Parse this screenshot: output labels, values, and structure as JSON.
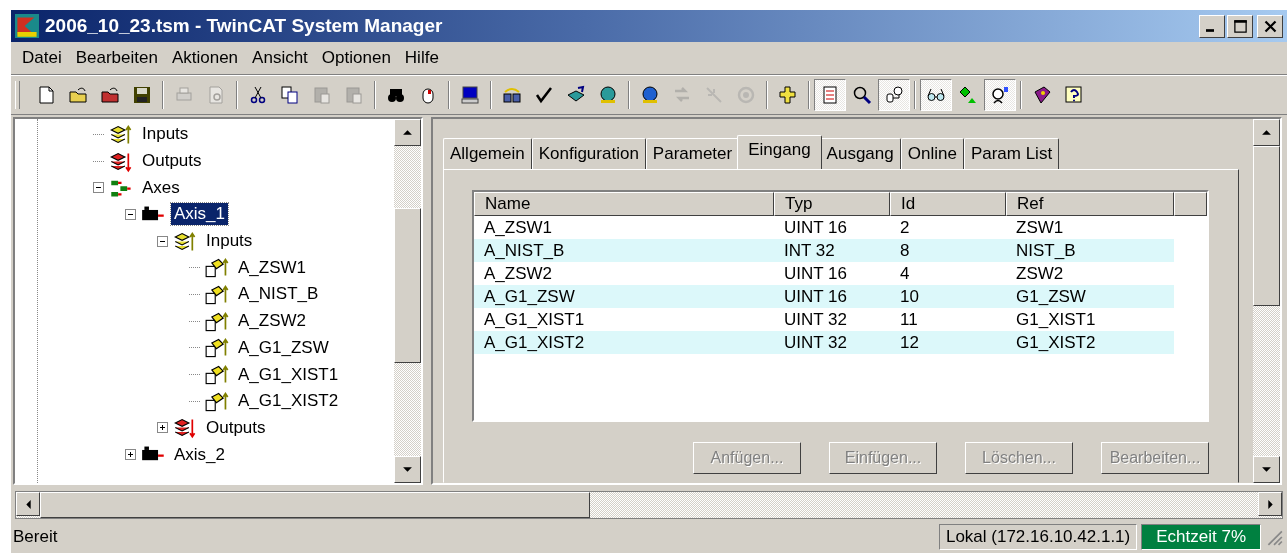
{
  "window": {
    "title": "2006_10_23.tsm - TwinCAT System Manager"
  },
  "menu": [
    "Datei",
    "Bearbeiten",
    "Aktionen",
    "Ansicht",
    "Optionen",
    "Hilfe"
  ],
  "toolbar": [
    {
      "kind": "new",
      "disabled": false,
      "pressed": false
    },
    {
      "kind": "open",
      "disabled": false,
      "pressed": false
    },
    {
      "kind": "open-red",
      "disabled": false,
      "pressed": false
    },
    {
      "kind": "save",
      "disabled": false,
      "pressed": false
    },
    {
      "kind": "separator"
    },
    {
      "kind": "print",
      "disabled": true,
      "pressed": false
    },
    {
      "kind": "preview",
      "disabled": true,
      "pressed": false
    },
    {
      "kind": "separator"
    },
    {
      "kind": "cut",
      "disabled": false,
      "pressed": false
    },
    {
      "kind": "copy",
      "disabled": false,
      "pressed": false
    },
    {
      "kind": "paste",
      "disabled": true,
      "pressed": false
    },
    {
      "kind": "paste",
      "disabled": true,
      "pressed": false
    },
    {
      "kind": "separator"
    },
    {
      "kind": "find",
      "disabled": false,
      "pressed": false
    },
    {
      "kind": "mouse",
      "disabled": false,
      "pressed": false
    },
    {
      "kind": "separator"
    },
    {
      "kind": "computer",
      "disabled": false,
      "pressed": false
    },
    {
      "kind": "separator"
    },
    {
      "kind": "modules",
      "disabled": false,
      "pressed": false
    },
    {
      "kind": "check",
      "disabled": false,
      "pressed": false
    },
    {
      "kind": "build",
      "disabled": false,
      "pressed": false
    },
    {
      "kind": "target",
      "disabled": false,
      "pressed": false
    },
    {
      "kind": "separator"
    },
    {
      "kind": "target-blue",
      "disabled": false,
      "pressed": false
    },
    {
      "kind": "transfer",
      "disabled": true,
      "pressed": false
    },
    {
      "kind": "wand",
      "disabled": true,
      "pressed": false
    },
    {
      "kind": "reload",
      "disabled": true,
      "pressed": false
    },
    {
      "kind": "separator"
    },
    {
      "kind": "add",
      "disabled": false,
      "pressed": false
    },
    {
      "kind": "separator"
    },
    {
      "kind": "list",
      "disabled": false,
      "pressed": true
    },
    {
      "kind": "zoom",
      "disabled": false,
      "pressed": false
    },
    {
      "kind": "plug",
      "disabled": false,
      "pressed": true
    },
    {
      "kind": "separator"
    },
    {
      "kind": "glasses",
      "disabled": false,
      "pressed": true
    },
    {
      "kind": "diamond",
      "disabled": false,
      "pressed": false
    },
    {
      "kind": "person",
      "disabled": false,
      "pressed": true
    },
    {
      "kind": "separator"
    },
    {
      "kind": "book",
      "disabled": false,
      "pressed": false
    },
    {
      "kind": "help",
      "disabled": false,
      "pressed": false
    }
  ],
  "tree": [
    {
      "label": "Inputs",
      "kind": "inputs",
      "selected": false
    },
    {
      "label": "Outputs",
      "kind": "outputs",
      "selected": false
    },
    {
      "label": "Axes",
      "kind": "axes",
      "selected": false,
      "expanded": true,
      "children": [
        {
          "label": "Axis_1",
          "kind": "axis",
          "selected": true,
          "expanded": true,
          "children": [
            {
              "label": "Inputs",
              "kind": "inputs",
              "selected": false,
              "expanded": true,
              "children": [
                {
                  "label": "A_ZSW1",
                  "kind": "variable",
                  "selected": false
                },
                {
                  "label": "A_NIST_B",
                  "kind": "variable",
                  "selected": false
                },
                {
                  "label": "A_ZSW2",
                  "kind": "variable",
                  "selected": false
                },
                {
                  "label": "A_G1_ZSW",
                  "kind": "variable",
                  "selected": false
                },
                {
                  "label": "A_G1_XIST1",
                  "kind": "variable",
                  "selected": false
                },
                {
                  "label": "A_G1_XIST2",
                  "kind": "variable",
                  "selected": false
                }
              ]
            },
            {
              "label": "Outputs",
              "kind": "outputs",
              "selected": false,
              "expanded": false
            }
          ]
        },
        {
          "label": "Axis_2",
          "kind": "axis",
          "selected": false,
          "expanded": false
        }
      ]
    }
  ],
  "tabs": [
    {
      "label": "Allgemein",
      "selected": false
    },
    {
      "label": "Konfiguration",
      "selected": false
    },
    {
      "label": "Parameter",
      "selected": false
    },
    {
      "label": "Eingang",
      "selected": true
    },
    {
      "label": "Ausgang",
      "selected": false
    },
    {
      "label": "Online",
      "selected": false
    },
    {
      "label": "Param List",
      "selected": false
    }
  ],
  "table": {
    "columns": [
      "Name",
      "Typ",
      "Id",
      "Ref"
    ],
    "rows": [
      [
        "A_ZSW1",
        "UINT 16",
        "2",
        "ZSW1"
      ],
      [
        "A_NIST_B",
        "INT 32",
        "8",
        "NIST_B"
      ],
      [
        "A_ZSW2",
        "UINT 16",
        "4",
        "ZSW2"
      ],
      [
        "A_G1_ZSW",
        "UINT 16",
        "10",
        "G1_ZSW"
      ],
      [
        "A_G1_XIST1",
        "UINT 32",
        "11",
        "G1_XIST1"
      ],
      [
        "A_G1_XIST2",
        "UINT 32",
        "12",
        "G1_XIST2"
      ]
    ]
  },
  "buttons": [
    {
      "label": "Anfügen...",
      "disabled": true
    },
    {
      "label": "Einfügen...",
      "disabled": true
    },
    {
      "label": "Löschen...",
      "disabled": true
    },
    {
      "label": "Bearbeiten...",
      "disabled": true
    }
  ],
  "status_bar": {
    "message": "Bereit",
    "connection": "Lokal (172.16.10.42.1.1)",
    "realtime": "Echtzeit 7%"
  }
}
